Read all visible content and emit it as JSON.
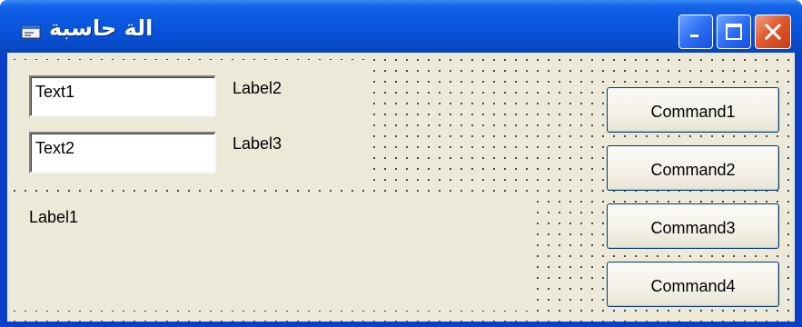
{
  "window": {
    "title": "الة حاسبة",
    "system_icon": "form-icon",
    "colors": {
      "titlebar": "#0a57e0",
      "client": "#ece9d8",
      "close": "#e05a30"
    }
  },
  "caption_buttons": {
    "minimize_icon": "minimize-icon",
    "maximize_icon": "maximize-icon",
    "close_icon": "close-icon"
  },
  "textboxes": [
    {
      "value": "Text1"
    },
    {
      "value": "Text2"
    }
  ],
  "labels": {
    "label1": "Label1",
    "label2": "Label2",
    "label3": "Label3"
  },
  "commands": [
    {
      "label": "Command1"
    },
    {
      "label": "Command2"
    },
    {
      "label": "Command3"
    },
    {
      "label": "Command4"
    }
  ]
}
